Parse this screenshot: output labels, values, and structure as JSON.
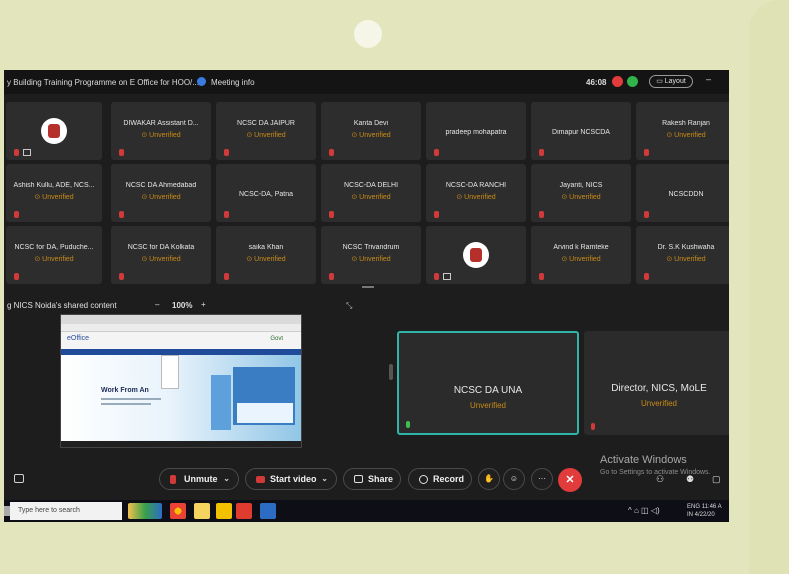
{
  "meeting": {
    "title": "y Building Training Programme on E Office for HOO/...",
    "info_label": "Meeting info",
    "timer": "46:08",
    "layout_label": "Layout",
    "minimize_glyph": "–"
  },
  "participants": [
    {
      "name": "",
      "status": "",
      "avatar": true
    },
    {
      "name": "DIWAKAR Assistant D...",
      "status": "Unverified"
    },
    {
      "name": "NCSC DA JAIPUR",
      "status": "Unverified"
    },
    {
      "name": "Kanta Devi",
      "status": "Unverified"
    },
    {
      "name": "pradeep mohapatra",
      "status": ""
    },
    {
      "name": "Dimapur NCSCDA",
      "status": ""
    },
    {
      "name": "Rakesh Ranjan",
      "status": "Unverified"
    },
    {
      "name": "Ashish Kullu, ADE, NCS...",
      "status": "Unverified"
    },
    {
      "name": "NCSC DA Ahmedabad",
      "status": "Unverified"
    },
    {
      "name": "NCSC-DA, Patna",
      "status": ""
    },
    {
      "name": "NCSC-DA DELHI",
      "status": "Unverified"
    },
    {
      "name": "NCSC-DA RANCHI",
      "status": "Unverified"
    },
    {
      "name": "Jayanti, NICS",
      "status": "Unverified"
    },
    {
      "name": "NCSCDDN",
      "status": ""
    },
    {
      "name": "NCSC for DA, Puduche...",
      "status": "Unverified"
    },
    {
      "name": "NCSC for DA Kolkata",
      "status": "Unverified"
    },
    {
      "name": "saika Khan",
      "status": "Unverified"
    },
    {
      "name": "NCSC Trivandrum",
      "status": "Unverified"
    },
    {
      "name": "",
      "status": "",
      "avatar": true
    },
    {
      "name": "Arvind k Ramteke",
      "status": "Unverified"
    },
    {
      "name": "Dr. S.K Kushwaha",
      "status": "Unverified"
    }
  ],
  "share": {
    "label": "g NICS Noida's shared content",
    "zoom_minus": "–",
    "zoom": "100%",
    "zoom_plus": "+",
    "shared_title": "Work From An",
    "logo_text": "eOffice",
    "logo_right": "Govt"
  },
  "big_tiles": [
    {
      "name": "NCSC DA UNA",
      "status": "Unverified"
    },
    {
      "name": "Director, NICS, MoLE",
      "status": "Unverified"
    }
  ],
  "controls": {
    "unmute": "Unmute",
    "start_video": "Start video",
    "share": "Share",
    "record": "Record",
    "more": "···",
    "leave": "✕"
  },
  "watermark": {
    "line1": "Activate Windows",
    "line2": "Go to Settings to activate Windows."
  },
  "taskbar": {
    "search_placeholder": "Type here to search",
    "lang1": "ENG",
    "lang2": "IN",
    "time": "11:46 A",
    "date": "4/22/20"
  },
  "colors": {
    "background": "#e3e6bd",
    "unverified": "#c98b17",
    "active_border": "#2fb4a9",
    "leave": "#e23b3b"
  }
}
